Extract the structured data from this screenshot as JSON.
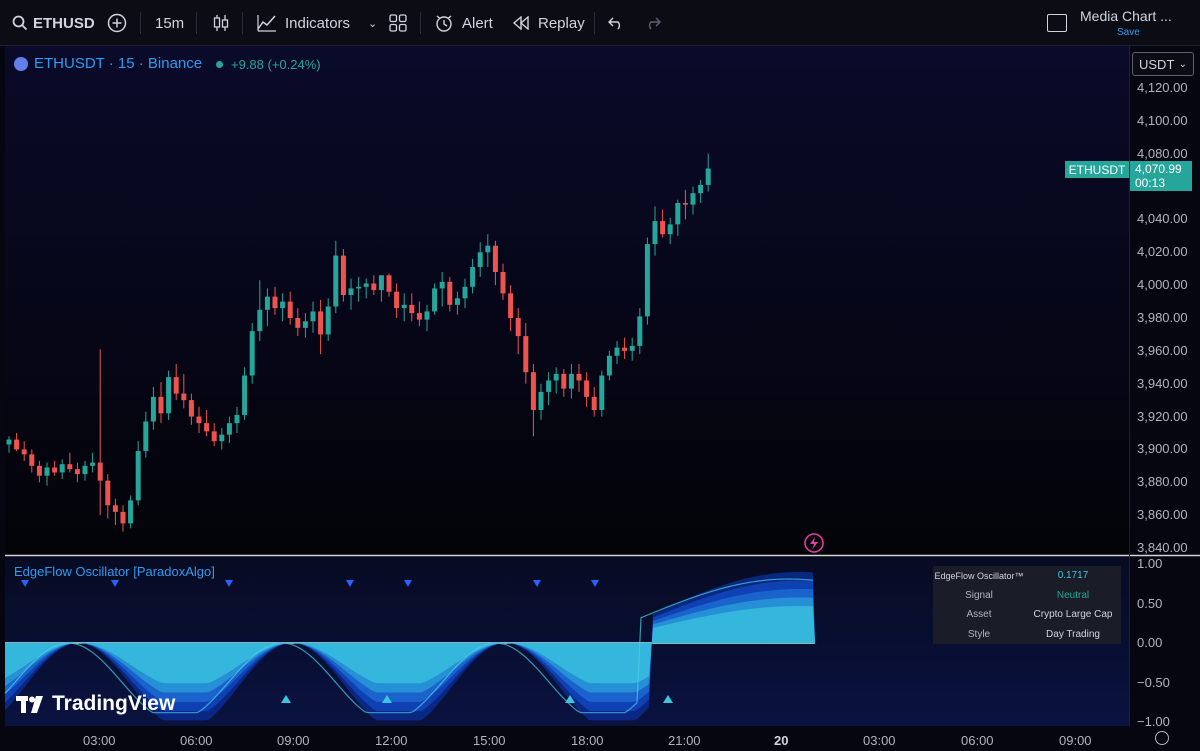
{
  "toolbar": {
    "symbol": "ETHUSD",
    "interval": "15m",
    "indicators_label": "Indicators",
    "alert_label": "Alert",
    "replay_label": "Replay",
    "layout_name": "Media Chart ...",
    "save_label": "Save"
  },
  "legend": {
    "title": "ETHUSDT · 15 · Binance",
    "change": "+9.88 (+0.24%)"
  },
  "currency": "USDT",
  "price_axis": [
    "4,120.00",
    "4,100.00",
    "4,080.00",
    "4,040.00",
    "4,020.00",
    "4,000.00",
    "3,980.00",
    "3,960.00",
    "3,940.00",
    "3,920.00",
    "3,900.00",
    "3,880.00",
    "3,860.00",
    "3,840.00"
  ],
  "last_price": {
    "symbol": "ETHUSDT",
    "price": "4,070.99",
    "countdown": "00:13"
  },
  "oscillator": {
    "name": "EdgeFlow Oscillator [ParadoxAlgo]",
    "axis": [
      "1.00",
      "0.50",
      "0.00",
      "−0.50",
      "−1.00"
    ],
    "table": {
      "header_label": "EdgeFlow Oscillator™",
      "header_value": "0.1717",
      "rows": [
        {
          "label": "Signal",
          "value": "Neutral"
        },
        {
          "label": "Asset",
          "value": "Crypto Large Cap"
        },
        {
          "label": "Style",
          "value": "Day Trading"
        }
      ]
    }
  },
  "time_axis": [
    "03:00",
    "06:00",
    "09:00",
    "12:00",
    "15:00",
    "18:00",
    "21:00",
    "20",
    "03:00",
    "06:00",
    "09:00"
  ],
  "brand": "TradingView",
  "colors": {
    "up": "#26a69a",
    "down": "#ef5350",
    "accent": "#2f9bf0",
    "osc": "#3bc6e0"
  },
  "candles": [
    [
      3903,
      3908,
      3898,
      3906
    ],
    [
      3906,
      3910,
      3899,
      3900
    ],
    [
      3900,
      3905,
      3893,
      3897
    ],
    [
      3897,
      3900,
      3886,
      3890
    ],
    [
      3890,
      3893,
      3880,
      3884
    ],
    [
      3884,
      3892,
      3878,
      3889
    ],
    [
      3889,
      3893,
      3884,
      3886
    ],
    [
      3886,
      3894,
      3882,
      3891
    ],
    [
      3891,
      3898,
      3886,
      3888
    ],
    [
      3888,
      3892,
      3880,
      3885
    ],
    [
      3885,
      3893,
      3881,
      3890
    ],
    [
      3890,
      3898,
      3886,
      3892
    ],
    [
      3892,
      3961,
      3860,
      3881
    ],
    [
      3881,
      3885,
      3858,
      3866
    ],
    [
      3866,
      3870,
      3854,
      3862
    ],
    [
      3862,
      3866,
      3850,
      3855
    ],
    [
      3855,
      3872,
      3852,
      3869
    ],
    [
      3869,
      3905,
      3866,
      3899
    ],
    [
      3899,
      3923,
      3895,
      3917
    ],
    [
      3917,
      3938,
      3912,
      3932
    ],
    [
      3932,
      3941,
      3916,
      3922
    ],
    [
      3922,
      3948,
      3918,
      3944
    ],
    [
      3944,
      3952,
      3930,
      3934
    ],
    [
      3934,
      3946,
      3925,
      3930
    ],
    [
      3930,
      3934,
      3915,
      3920
    ],
    [
      3920,
      3926,
      3910,
      3916
    ],
    [
      3916,
      3924,
      3908,
      3911
    ],
    [
      3911,
      3916,
      3902,
      3905
    ],
    [
      3905,
      3913,
      3900,
      3909
    ],
    [
      3909,
      3920,
      3904,
      3916
    ],
    [
      3916,
      3926,
      3910,
      3921
    ],
    [
      3921,
      3950,
      3918,
      3945
    ],
    [
      3945,
      3977,
      3940,
      3972
    ],
    [
      3972,
      4003,
      3966,
      3985
    ],
    [
      3985,
      3998,
      3975,
      3993
    ],
    [
      3993,
      3999,
      3982,
      3986
    ],
    [
      3986,
      3995,
      3978,
      3990
    ],
    [
      3990,
      3996,
      3976,
      3980
    ],
    [
      3980,
      3986,
      3969,
      3974
    ],
    [
      3974,
      3983,
      3968,
      3978
    ],
    [
      3978,
      3990,
      3971,
      3984
    ],
    [
      3984,
      3991,
      3958,
      3970
    ],
    [
      3970,
      3992,
      3966,
      3987
    ],
    [
      3987,
      4027,
      3983,
      4018
    ],
    [
      4018,
      4022,
      3990,
      3994
    ],
    [
      3994,
      4004,
      3985,
      3998
    ],
    [
      3998,
      4005,
      3990,
      3999
    ],
    [
      3999,
      4004,
      3992,
      4001
    ],
    [
      4001,
      4006,
      3994,
      3997
    ],
    [
      3997,
      4003,
      3990,
      4006
    ],
    [
      4006,
      4007,
      3993,
      3996
    ],
    [
      3996,
      4001,
      3980,
      3986
    ],
    [
      3986,
      3995,
      3978,
      3988
    ],
    [
      3988,
      3995,
      3978,
      3983
    ],
    [
      3983,
      3990,
      3975,
      3979
    ],
    [
      3979,
      3988,
      3972,
      3984
    ],
    [
      3984,
      4001,
      3982,
      3998
    ],
    [
      3998,
      4008,
      3987,
      4002
    ],
    [
      4002,
      4005,
      3984,
      3988
    ],
    [
      3988,
      3996,
      3982,
      3992
    ],
    [
      3992,
      4004,
      3986,
      3999
    ],
    [
      3999,
      4016,
      3995,
      4011
    ],
    [
      4011,
      4026,
      4005,
      4020
    ],
    [
      4020,
      4031,
      4011,
      4024
    ],
    [
      4024,
      4027,
      4000,
      4008
    ],
    [
      4008,
      4013,
      3991,
      3995
    ],
    [
      3995,
      4000,
      3972,
      3980
    ],
    [
      3980,
      3986,
      3958,
      3969
    ],
    [
      3969,
      3977,
      3940,
      3947
    ],
    [
      3947,
      3952,
      3908,
      3924
    ],
    [
      3924,
      3940,
      3918,
      3935
    ],
    [
      3935,
      3947,
      3927,
      3942
    ],
    [
      3942,
      3950,
      3934,
      3946
    ],
    [
      3946,
      3949,
      3932,
      3937
    ],
    [
      3937,
      3952,
      3931,
      3946
    ],
    [
      3946,
      3952,
      3935,
      3942
    ],
    [
      3942,
      3947,
      3926,
      3932
    ],
    [
      3932,
      3938,
      3920,
      3924
    ],
    [
      3924,
      3948,
      3920,
      3945
    ],
    [
      3945,
      3960,
      3942,
      3957
    ],
    [
      3957,
      3966,
      3952,
      3962
    ],
    [
      3962,
      3968,
      3955,
      3960
    ],
    [
      3960,
      3968,
      3954,
      3963
    ],
    [
      3963,
      3986,
      3958,
      3981
    ],
    [
      3981,
      4029,
      3976,
      4025
    ],
    [
      4025,
      4048,
      4018,
      4039
    ],
    [
      4039,
      4046,
      4029,
      4031
    ],
    [
      4031,
      4041,
      4025,
      4037
    ],
    [
      4037,
      4052,
      4030,
      4050
    ],
    [
      4050,
      4058,
      4040,
      4049
    ],
    [
      4049,
      4060,
      4043,
      4056
    ],
    [
      4056,
      4064,
      4050,
      4061
    ],
    [
      4061,
      4080,
      4057,
      4071
    ]
  ]
}
